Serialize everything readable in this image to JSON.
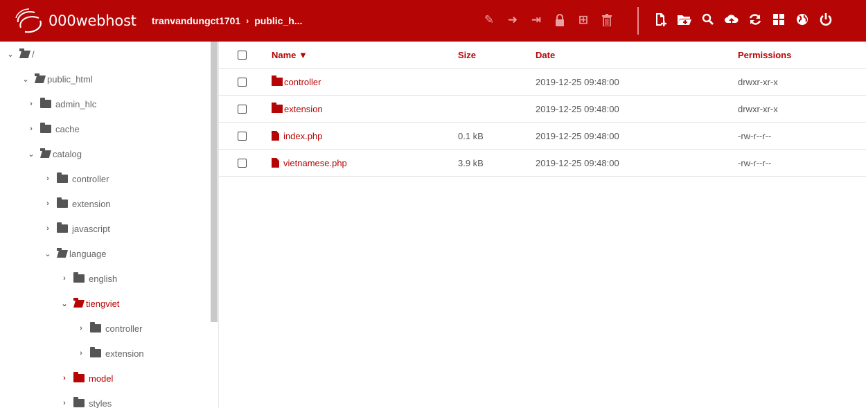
{
  "header": {
    "brand": "000webhost",
    "breadcrumb": [
      "tranvandungct1701",
      "public_h..."
    ],
    "breadcrumb_separator": "›",
    "file_tools": [
      "edit-icon",
      "move-icon",
      "rename-icon",
      "lock-icon",
      "extract-icon",
      "trash-icon"
    ],
    "main_tools": [
      "new-file-icon",
      "new-folder-icon",
      "search-icon",
      "upload-icon",
      "refresh-icon",
      "grid-view-icon",
      "globe-icon",
      "power-icon"
    ],
    "colors": {
      "bar": "#b50505",
      "disabled_icon": "#e8a0a0"
    }
  },
  "tree": {
    "items": [
      {
        "label": "/",
        "depth": 0,
        "expanded": true,
        "active": false
      },
      {
        "label": "public_html",
        "depth": 1,
        "expanded": true,
        "active": false
      },
      {
        "label": "admin_hlc",
        "depth": 2,
        "expanded": false,
        "active": false
      },
      {
        "label": "cache",
        "depth": 2,
        "expanded": false,
        "active": false
      },
      {
        "label": "catalog",
        "depth": 2,
        "expanded": true,
        "active": false
      },
      {
        "label": "controller",
        "depth": 3,
        "expanded": false,
        "active": false
      },
      {
        "label": "extension",
        "depth": 3,
        "expanded": false,
        "active": false
      },
      {
        "label": "javascript",
        "depth": 3,
        "expanded": false,
        "active": false
      },
      {
        "label": "language",
        "depth": 3,
        "expanded": true,
        "active": false
      },
      {
        "label": "english",
        "depth": 4,
        "expanded": false,
        "active": false
      },
      {
        "label": "tiengviet",
        "depth": 4,
        "expanded": true,
        "active": true
      },
      {
        "label": "controller",
        "depth": 5,
        "expanded": false,
        "active": false
      },
      {
        "label": "extension",
        "depth": 5,
        "expanded": false,
        "active": false
      },
      {
        "label": "model",
        "depth": 4,
        "expanded": false,
        "active": true
      },
      {
        "label": "styles",
        "depth": 4,
        "expanded": false,
        "active": false
      }
    ]
  },
  "files": {
    "columns": {
      "name": "Name ▼",
      "size": "Size",
      "date": "Date",
      "permissions": "Permissions"
    },
    "rows": [
      {
        "type": "folder",
        "name": "controller",
        "size": "",
        "date": "2019-12-25 09:48:00",
        "permissions": "drwxr-xr-x"
      },
      {
        "type": "folder",
        "name": "extension",
        "size": "",
        "date": "2019-12-25 09:48:00",
        "permissions": "drwxr-xr-x"
      },
      {
        "type": "file",
        "name": "index.php",
        "size": "0.1 kB",
        "date": "2019-12-25 09:48:00",
        "permissions": "-rw-r--r--"
      },
      {
        "type": "file",
        "name": "vietnamese.php",
        "size": "3.9 kB",
        "date": "2019-12-25 09:48:00",
        "permissions": "-rw-r--r--"
      }
    ]
  }
}
